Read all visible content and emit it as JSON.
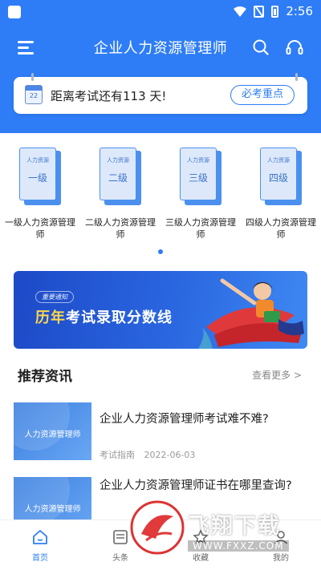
{
  "status_bar": {
    "time": "2:56"
  },
  "header": {
    "title": "企业人力资源管理师"
  },
  "countdown": {
    "calendar_day": "22",
    "text": "距离考试还有113 天!",
    "button": "必考重点"
  },
  "levels": [
    {
      "cover_small": "人力资源",
      "cover_big": "一级",
      "label": "一级人力资源管理师"
    },
    {
      "cover_small": "人力资源",
      "cover_big": "二级",
      "label": "二级人力资源管理师"
    },
    {
      "cover_small": "人力资源",
      "cover_big": "三级",
      "label": "三级人力资源管理师"
    },
    {
      "cover_small": "人力资源",
      "cover_big": "四级",
      "label": "四级人力资源管理师"
    }
  ],
  "banner": {
    "tag": "重要通知",
    "title_highlight": "历年",
    "title_rest": "考试录取分数线"
  },
  "news_section": {
    "title": "推荐资讯",
    "more": "查看更多 >"
  },
  "news": [
    {
      "thumb_text": "人力资源管理师",
      "title": "企业人力资源管理师考试难不难?",
      "category": "考试指南",
      "date": "2022-06-03"
    },
    {
      "thumb_text": "人力资源管理师",
      "title": "企业人力资源管理师证书在哪里查询?",
      "category": "",
      "date": ""
    }
  ],
  "tabs": [
    {
      "label": "首页"
    },
    {
      "label": "头条"
    },
    {
      "label": "收藏"
    },
    {
      "label": "我的"
    }
  ],
  "watermark": {
    "title": "飞翔下载",
    "url": "WWW.FXXZ.COM"
  },
  "colors": {
    "primary": "#2e7df6",
    "highlight": "#ffd84a"
  }
}
